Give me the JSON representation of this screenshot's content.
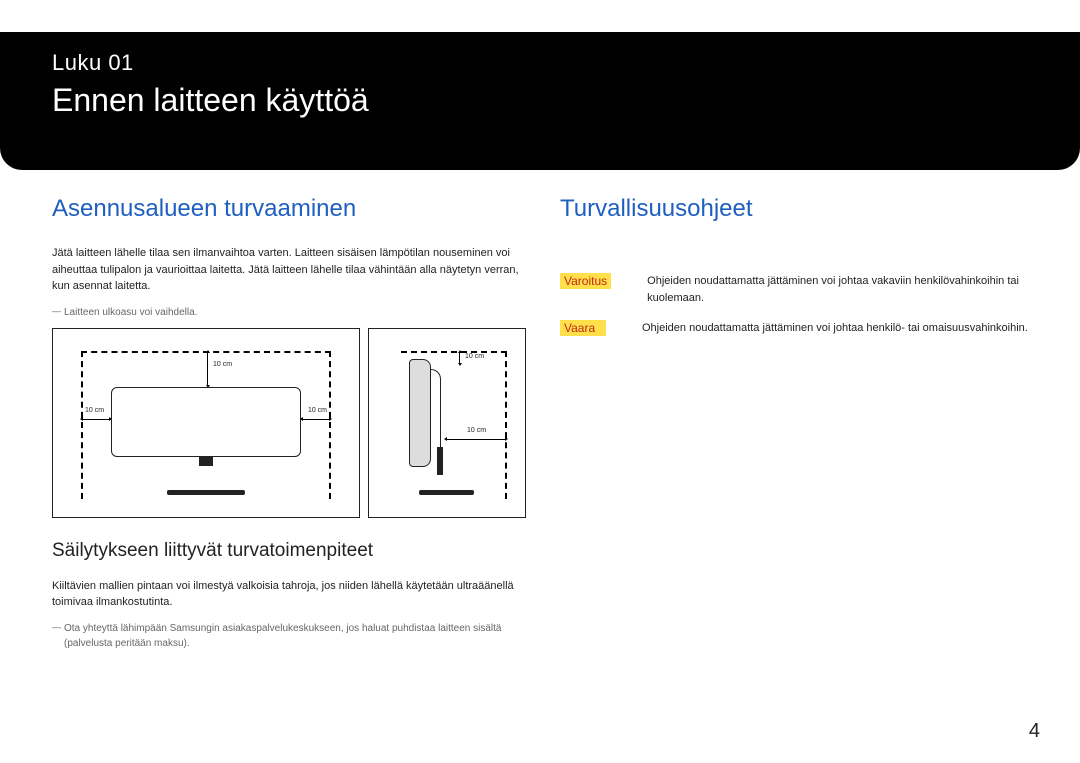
{
  "header": {
    "chapter_label": "Luku 01",
    "chapter_title": "Ennen laitteen käyttöä"
  },
  "left": {
    "heading": "Asennusalueen turvaaminen",
    "body1": "Jätä laitteen lähelle tilaa sen ilmanvaihtoa varten. Laitteen sisäisen lämpötilan nouseminen voi aiheuttaa tulipalon ja vaurioittaa laitetta. Jätä laitteen lähelle tilaa vähintään alla näytetyn verran, kun asennat laitetta.",
    "note1": "Laitteen ulkoasu voi vaihdella.",
    "clearance": {
      "top_front": "10 cm",
      "left_front": "10 cm",
      "right_front": "10 cm",
      "top_side": "10 cm",
      "back_side": "10 cm"
    },
    "subheading": "Säilytykseen liittyvät turvatoimenpiteet",
    "body2": "Kiiltävien mallien pintaan voi ilmestyä valkoisia tahroja, jos niiden lähellä käytetään ultraäänellä toimivaa ilmankostutinta.",
    "note2": "Ota yhteyttä lähimpään Samsungin asiakaspalvelukeskukseen, jos haluat puhdistaa laitteen sisältä (palvelusta peritään maksu)."
  },
  "right": {
    "heading": "Turvallisuusohjeet",
    "rows": [
      {
        "tag": "Varoitus",
        "text": "Ohjeiden noudattamatta jättäminen voi johtaa vakaviin henkilövahinkoihin tai kuolemaan."
      },
      {
        "tag": "Vaara",
        "text": "Ohjeiden noudattamatta jättäminen voi johtaa henkilö- tai omaisuusvahinkoihin."
      }
    ]
  },
  "page_number": "4"
}
